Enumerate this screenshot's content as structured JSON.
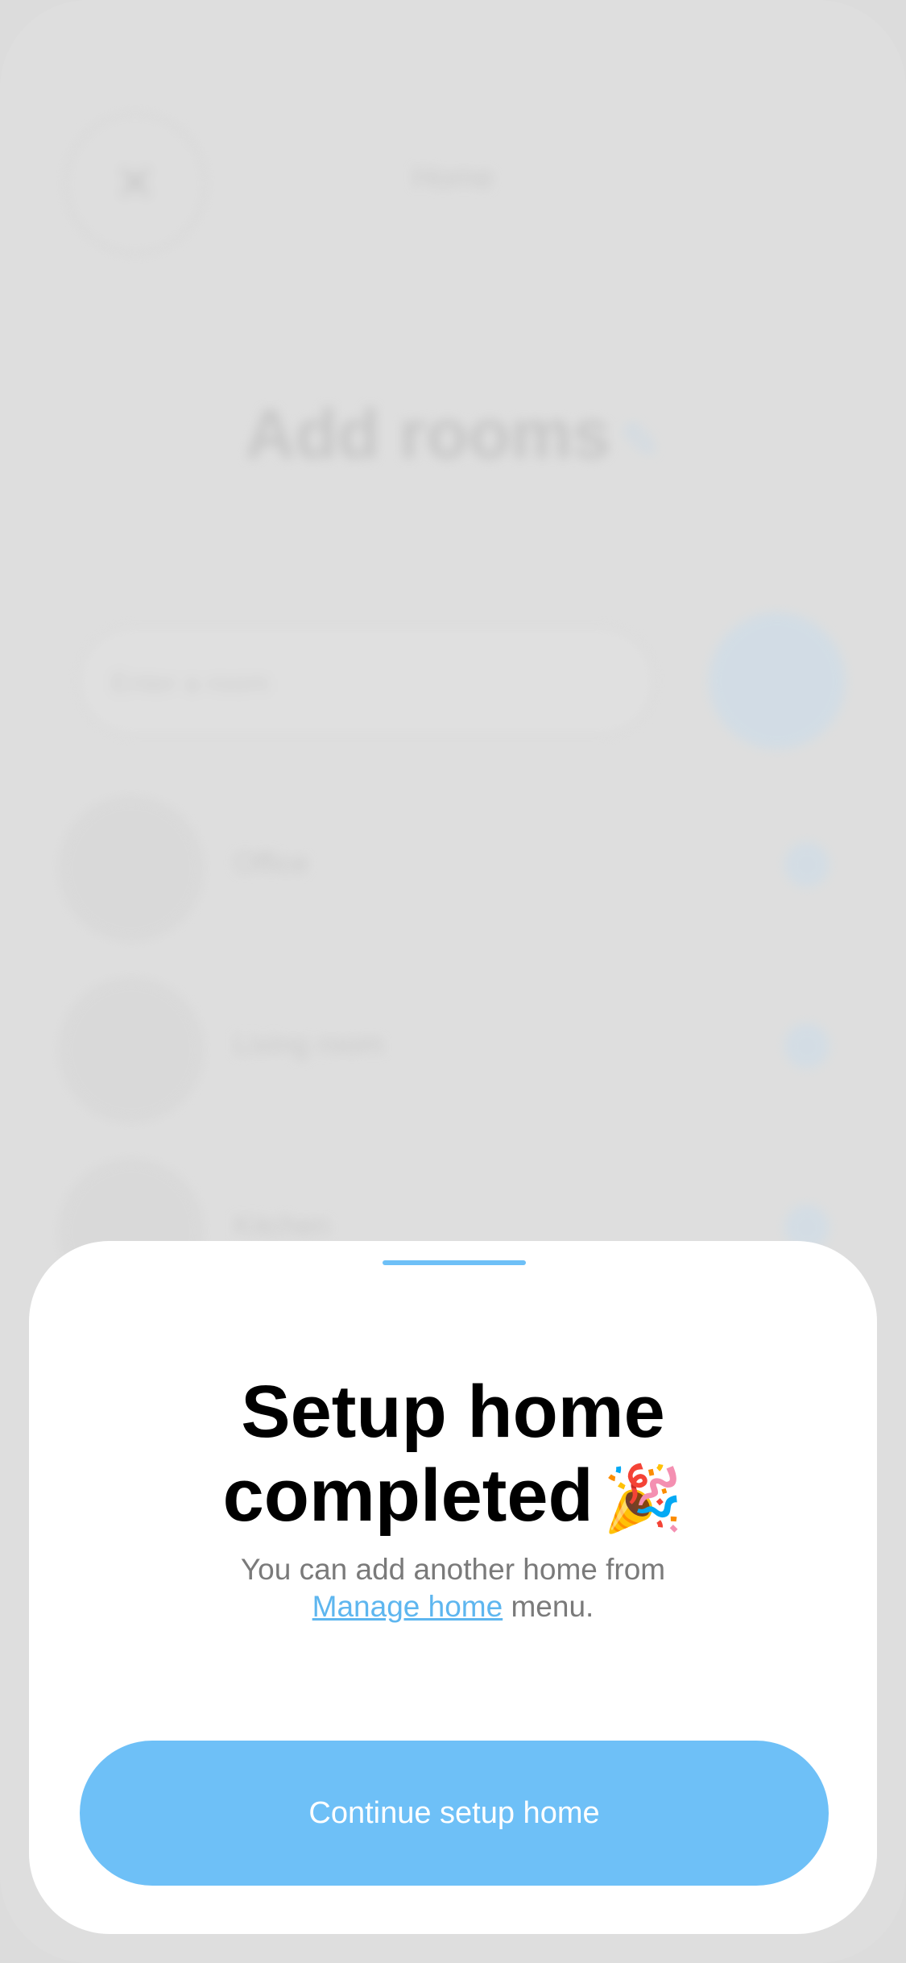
{
  "background": {
    "top_title": "Home",
    "page_title": "Add rooms",
    "page_title_accent": "✎",
    "search_placeholder": "Enter a room",
    "rooms": [
      {
        "label": "Office"
      },
      {
        "label": "Living room"
      },
      {
        "label": "Kitchen"
      }
    ]
  },
  "sheet": {
    "title_line1": "Setup home",
    "title_line2": "completed",
    "party_icon": "🎉",
    "subtitle_line1": "You can add another home from",
    "link_text": "Manage home",
    "subtitle_tail": " menu.",
    "button_label": "Continue setup home"
  },
  "colors": {
    "accent": "#6ec0f7",
    "sheet_bg": "#ffffff",
    "backdrop": "#dedede"
  }
}
